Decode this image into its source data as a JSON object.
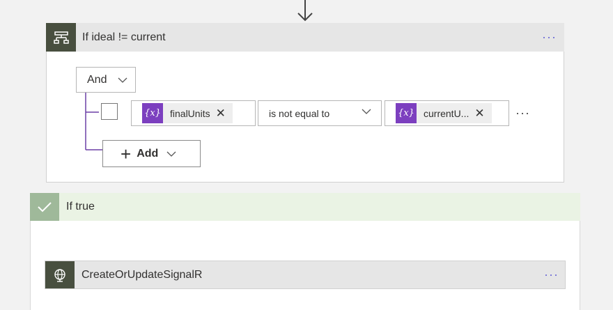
{
  "condition": {
    "title": "If ideal != current",
    "more_label": "···",
    "group_operator": "And",
    "row": {
      "left_token": "finalUnits",
      "operator": "is not equal to",
      "right_token": "currentU...",
      "token_icon": "{x}",
      "remove_glyph": "✕",
      "more_label": "···"
    },
    "add_label": "Add",
    "add_glyph": "+"
  },
  "true_branch": {
    "title": "If true",
    "action": {
      "title": "CreateOrUpdateSignalR",
      "more_label": "···"
    }
  },
  "colors": {
    "accent": "#6b69d6",
    "condition_icon_bg": "#484f3f",
    "variable_token": "#7c3fbf",
    "true_header": "#eaf3e4",
    "true_icon_bg": "#9fb99a"
  },
  "icons": {
    "flow_arrow": "arrow-down-icon",
    "condition": "condition-icon",
    "check": "checkmark-icon",
    "action": "globe-icon"
  }
}
